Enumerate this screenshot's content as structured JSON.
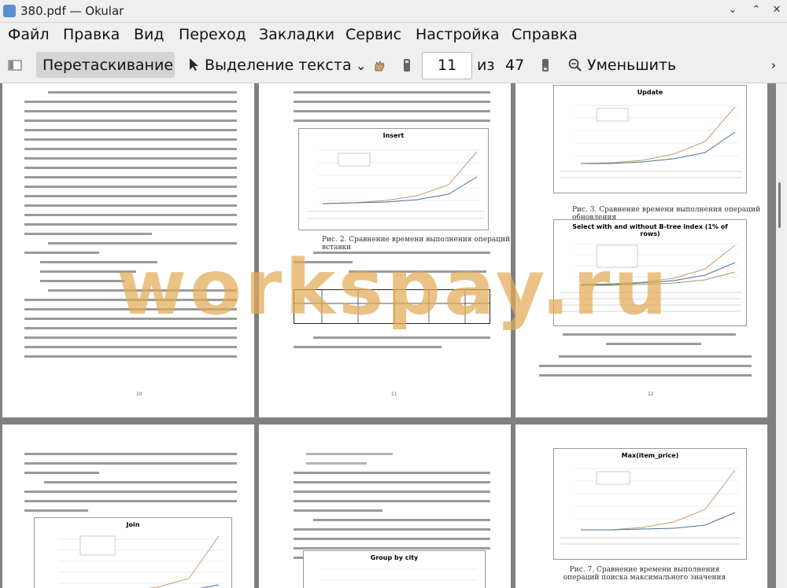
{
  "window": {
    "title": "380.pdf — Okular"
  },
  "menu": [
    "Файл",
    "Правка",
    "Вид",
    "Переход",
    "Закладки",
    "Сервис",
    "Настройка",
    "Справка"
  ],
  "toolbar": {
    "drag_label": "Перетаскивание",
    "select_label": "Выделение текста",
    "page_value": "11",
    "of_label": "из",
    "total_pages": "47",
    "zoom_label": "Уменьшить"
  },
  "pages": {
    "p10_number": "10",
    "p11_number": "11",
    "p12_number": "12",
    "chart_update": "Update",
    "chart_insert": "Insert",
    "chart_select": "Select with and without B-tree index (1% of rows)",
    "chart_join": "Join",
    "chart_group": "Group by city",
    "chart_max": "Max(item_price)",
    "caption_2": "Рис. 2. Сравнение времени выполнения операций вставки",
    "caption_3": "Рис. 3. Сравнение времени выполнения операций обновления",
    "caption_7": "Рис. 7. Сравнение времени выполнения операций поиска максимального значения"
  },
  "watermark": "workspay.ru"
}
